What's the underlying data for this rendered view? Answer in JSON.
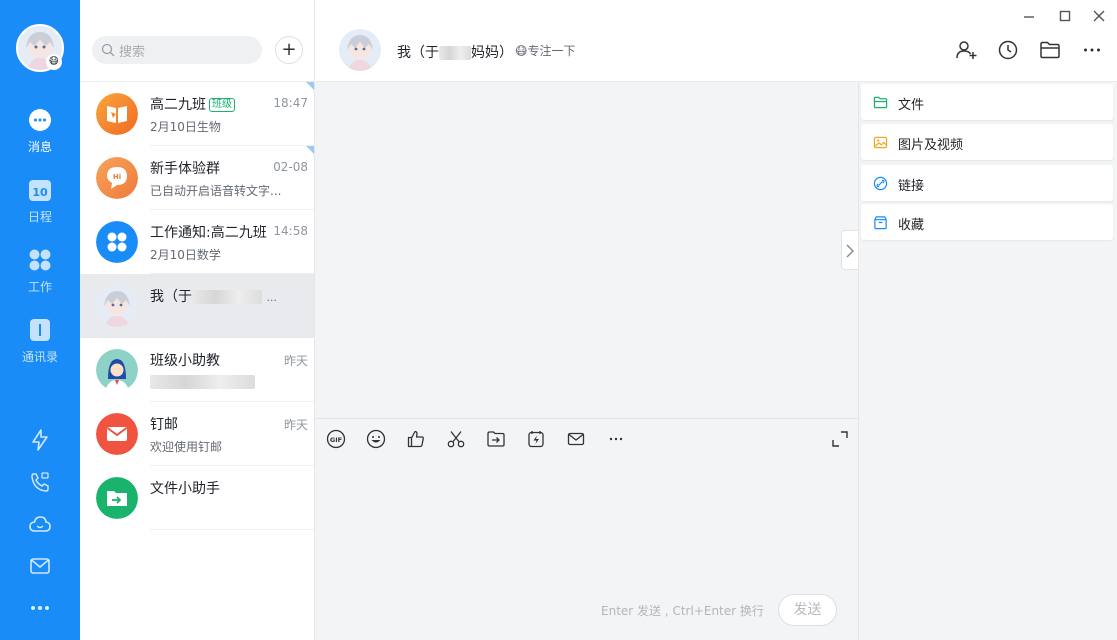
{
  "nav": {
    "items": [
      {
        "label": "消息",
        "badge": ""
      },
      {
        "label": "日程",
        "badge": "10"
      },
      {
        "label": "工作",
        "badge": ""
      },
      {
        "label": "通讯录",
        "badge": ""
      }
    ]
  },
  "search": {
    "placeholder": "搜索"
  },
  "add_button": "+",
  "conversations": [
    {
      "name": "高二九班",
      "tag": "班级",
      "sub": "2月10日生物",
      "time": "18:47"
    },
    {
      "name": "新手体验群",
      "sub": "已自动开启语音转文字...",
      "time": "02-08"
    },
    {
      "name": "工作通知:高二九班",
      "sub": "2月10日数学",
      "time": "14:58"
    },
    {
      "name": "我（于",
      "ellipsis": "...",
      "sub": "",
      "time": ""
    },
    {
      "name": "班级小助教",
      "sub": "",
      "time": "昨天"
    },
    {
      "name": "钉邮",
      "sub": "欢迎使用钉邮",
      "time": "昨天"
    },
    {
      "name": "文件小助手",
      "sub": "",
      "time": ""
    }
  ],
  "chat": {
    "title_prefix": "我（于",
    "title_suffix": "妈妈）",
    "status": "专注一下",
    "input_hint": "Enter 发送 , Ctrl+Enter 换行",
    "send_label": "发送"
  },
  "right_panel": {
    "items": [
      {
        "label": "文件",
        "icon": "folder-icon",
        "color": "#19b36b"
      },
      {
        "label": "图片及视频",
        "icon": "image-icon",
        "color": "#f5a623"
      },
      {
        "label": "链接",
        "icon": "link-icon",
        "color": "#1a8cf8"
      },
      {
        "label": "收藏",
        "icon": "favorite-box-icon",
        "color": "#1a8cf8"
      }
    ]
  },
  "colors": {
    "brand": "#1a8cf8",
    "chat_bg": "#f3f4f6",
    "selected_row": "#e9eaed"
  }
}
